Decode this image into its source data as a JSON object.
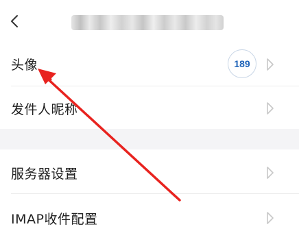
{
  "header": {
    "back_icon": "chevron-left-icon",
    "title": ""
  },
  "rows": [
    {
      "label": "头像",
      "badge": "189",
      "chevron_icon": "chevron-right-icon"
    },
    {
      "label": "发件人昵称",
      "chevron_icon": "chevron-right-icon"
    },
    {
      "label": "服务器设置",
      "chevron_icon": "chevron-right-icon"
    },
    {
      "label": "IMAP收件配置",
      "chevron_icon": "chevron-right-icon"
    }
  ],
  "annotation": {
    "type": "red-arrow",
    "color": "#e8231f",
    "points_to": "avatar-row"
  },
  "colors": {
    "badge_text": "#1e63b8",
    "badge_border": "#c9d6e6",
    "section_gap": "#f4f4f6",
    "chevron": "#c8c8c8"
  }
}
